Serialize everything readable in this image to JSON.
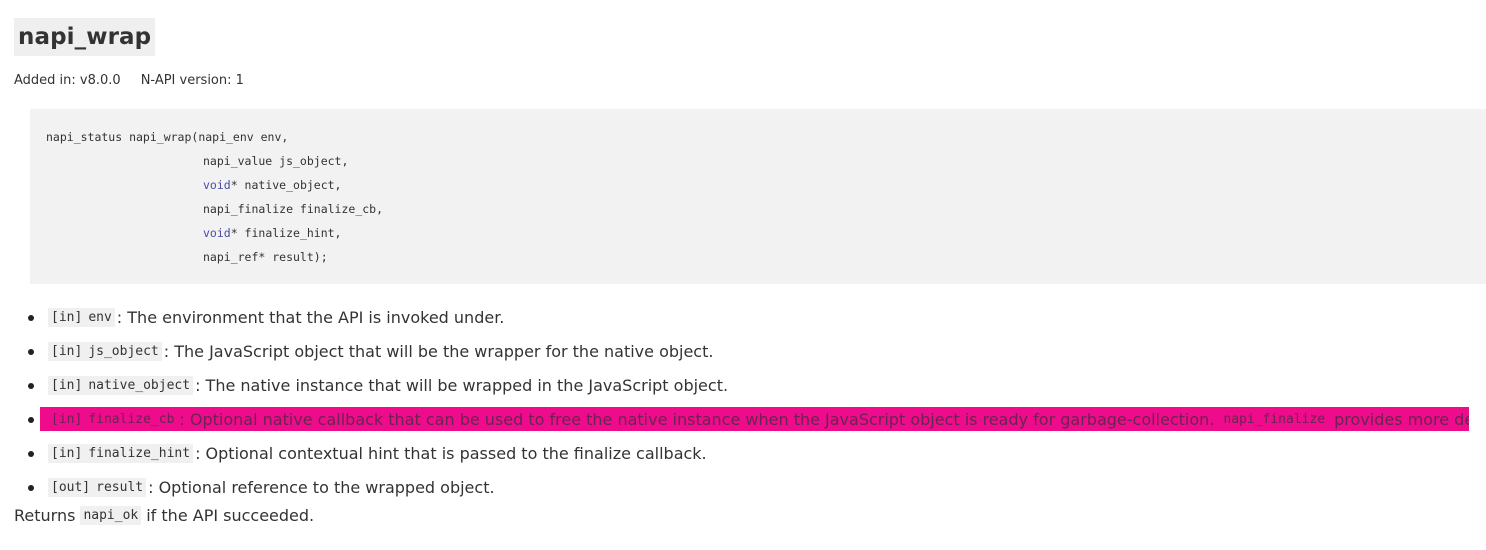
{
  "heading": "napi_wrap",
  "meta": {
    "added_in": "Added in: v8.0.0",
    "napi_version": "N-API version: 1"
  },
  "code": {
    "lines": [
      {
        "type": "",
        "rest": "napi_status napi_wrap(napi_env env,"
      },
      {
        "type": "",
        "rest": "napi_value js_object,"
      },
      {
        "type": "void",
        "rest": "* native_object,"
      },
      {
        "type": "",
        "rest": "napi_finalize finalize_cb,"
      },
      {
        "type": "void",
        "rest": "* finalize_hint,"
      },
      {
        "type": "",
        "rest": "napi_ref* result);"
      }
    ]
  },
  "params": [
    {
      "dir": "[in]",
      "name": "env",
      "desc": ": The environment that the API is invoked under."
    },
    {
      "dir": "[in]",
      "name": "js_object",
      "desc": ": The JavaScript object that will be the wrapper for the native object."
    },
    {
      "dir": "[in]",
      "name": "native_object",
      "desc": ": The native instance that will be wrapped in the JavaScript object."
    },
    {
      "dir": "[in]",
      "name": "finalize_cb",
      "desc": ": Optional native callback that can be used to free the native instance when the JavaScript object is ready for garbage-collection.",
      "link": "napi_finalize",
      "tail": "provides more details."
    },
    {
      "dir": "[in]",
      "name": "finalize_hint",
      "desc": ": Optional contextual hint that is passed to the finalize callback."
    },
    {
      "dir": "[out]",
      "name": "result",
      "desc": ": Optional reference to the wrapped object."
    }
  ],
  "returns": {
    "prefix": "Returns",
    "code": "napi_ok",
    "suffix": "if the API succeeded."
  },
  "colors": {
    "highlight": "#ee0c8c",
    "code_background": "#f2f2f2",
    "keyword": "#4a4aa8"
  }
}
